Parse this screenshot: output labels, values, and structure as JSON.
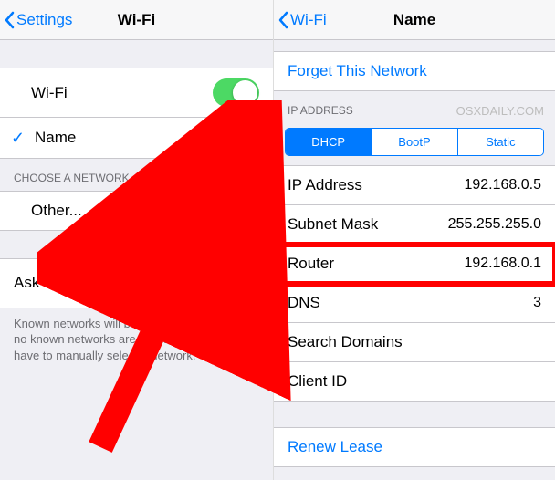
{
  "left": {
    "back_label": "Settings",
    "title": "Wi-Fi",
    "wifi_row_label": "Wi-Fi",
    "network_name": "Name",
    "choose_header": "CHOOSE A NETWORK...",
    "other_label": "Other...",
    "ask_join_label": "Ask to Join Networks",
    "footer": "Known networks will be joined automatically. If no known networks are available, you will have to manually select a network."
  },
  "right": {
    "back_label": "Wi-Fi",
    "title": "Name",
    "forget_label": "Forget This Network",
    "ip_header": "IP ADDRESS",
    "watermark": "osxdaily.com",
    "tabs": {
      "dhcp": "DHCP",
      "bootp": "BootP",
      "static": "Static"
    },
    "rows": {
      "ip_label": "IP Address",
      "ip_value": "192.168.0.5",
      "subnet_label": "Subnet Mask",
      "subnet_value": "255.255.255.0",
      "router_label": "Router",
      "router_value": "192.168.0.1",
      "dns_label": "DNS",
      "dns_value": "3",
      "search_label": "Search Domains",
      "client_label": "Client ID"
    },
    "renew_label": "Renew Lease"
  },
  "icons": {
    "lock": "lock-icon",
    "wifi": "wifi-signal-icon",
    "info": "info-icon",
    "check": "checkmark-icon",
    "back": "chevron-left-icon",
    "spinner": "spinner-icon"
  },
  "colors": {
    "accent": "#007aff",
    "highlight": "#ff0000",
    "toggle_on": "#4cd964"
  }
}
